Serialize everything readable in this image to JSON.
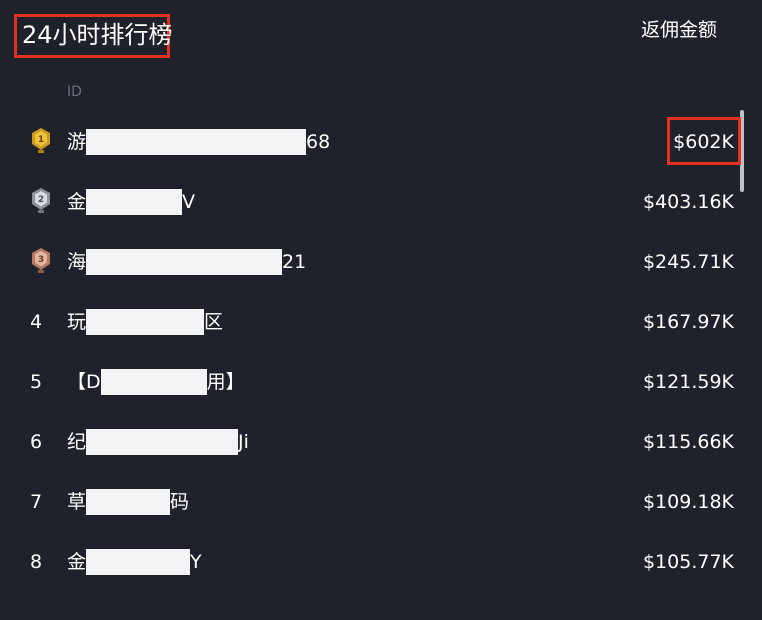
{
  "title": "24小时排行榜",
  "columns": {
    "id": "ID",
    "amount": "返佣金额"
  },
  "icons": {
    "gold": "gold-medal-icon",
    "silver": "silver-medal-icon",
    "bronze": "bronze-medal-icon"
  },
  "colors": {
    "background": "#1f222b",
    "highlight_border": "#e3321f",
    "text": "#ffffff",
    "muted_text": "#6b6f7b",
    "redaction": "#f4f4f6"
  },
  "rows": [
    {
      "rank": "1",
      "name_start": "游",
      "name_end": "68",
      "amount": "$602K",
      "highlighted": true
    },
    {
      "rank": "2",
      "name_start": "金",
      "name_end": "V",
      "amount": "$403.16K"
    },
    {
      "rank": "3",
      "name_start": "海",
      "name_end": "21",
      "amount": "$245.71K"
    },
    {
      "rank": "4",
      "name_start": "玩",
      "name_end": "区",
      "amount": "$167.97K"
    },
    {
      "rank": "5",
      "name_start": "【D",
      "name_end": "用】",
      "amount": "$121.59K"
    },
    {
      "rank": "6",
      "name_start": "纪",
      "name_end": "Ji",
      "amount": "$115.66K"
    },
    {
      "rank": "7",
      "name_start": "草",
      "name_end": "码",
      "amount": "$109.18K"
    },
    {
      "rank": "8",
      "name_start": "金",
      "name_end": "Y",
      "amount": "$105.77K"
    }
  ]
}
